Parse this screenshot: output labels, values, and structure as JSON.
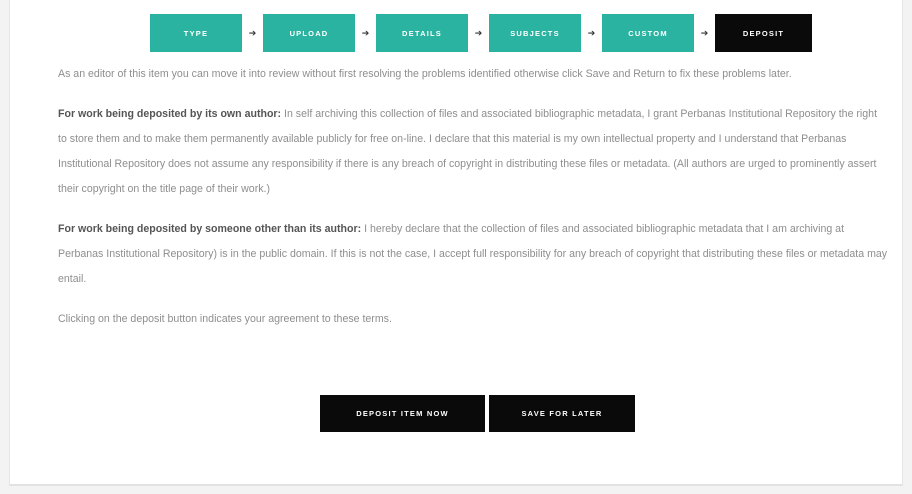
{
  "steps": [
    {
      "label": "TYPE",
      "state": "done"
    },
    {
      "label": "UPLOAD",
      "state": "done"
    },
    {
      "label": "DETAILS",
      "state": "done"
    },
    {
      "label": "SUBJECTS",
      "state": "done"
    },
    {
      "label": "CUSTOM",
      "state": "done"
    },
    {
      "label": "DEPOSIT",
      "state": "current"
    }
  ],
  "step_arrow_icon": "arrow-right-icon",
  "colors": {
    "step_done": "#2bb3a1",
    "step_current": "#0a0a0a",
    "button_bg": "#0a0a0a",
    "body_text": "#8e8e8e",
    "bold_text": "#555555"
  },
  "notice": "As an editor of this item you can move it into review without first resolving the problems identified otherwise click Save and Return to fix these problems later.",
  "own_author": {
    "heading": "For work being deposited by its own author:",
    "text": " In self archiving this collection of files and associated bibliographic metadata, I grant Perbanas Institutional Repository the right to store them and to make them permanently available publicly for free on-line. I declare that this material is my own intellectual property and I understand that Perbanas Institutional Repository does not assume any responsibility if there is any breach of copyright in distributing these files or metadata. (All authors are urged to prominently assert their copyright on the title page of their work.)"
  },
  "other_author": {
    "heading": "For work being deposited by someone other than its author:",
    "text": " I hereby declare that the collection of files and associated bibliographic metadata that I am archiving at Perbanas Institutional Repository) is in the public domain. If this is not the case, I accept full responsibility for any breach of copyright that distributing these files or metadata may entail."
  },
  "agreement": "Clicking on the deposit button indicates your agreement to these terms.",
  "actions": {
    "deposit_label": "DEPOSIT ITEM NOW",
    "save_label": "SAVE FOR LATER"
  }
}
